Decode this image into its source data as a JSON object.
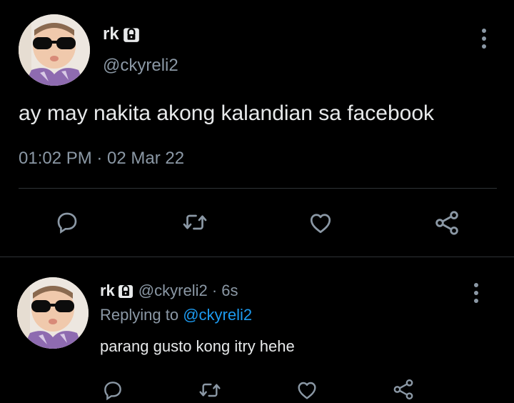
{
  "main_tweet": {
    "display_name": "rk",
    "handle": "@ckyreli2",
    "text": "ay may nakita akong kalandian sa facebook",
    "timestamp": "01:02 PM · 02 Mar 22",
    "icons": {
      "lock": "lock-icon",
      "more": "more-vertical-icon",
      "reply": "reply-icon",
      "retweet": "retweet-icon",
      "like": "heart-icon",
      "share": "share-icon"
    }
  },
  "reply_tweet": {
    "display_name": "rk",
    "handle_time": "@ckyreli2 · 6s",
    "replying_prefix": "Replying to",
    "replying_mention": "@ckyreli2",
    "text": "parang gusto kong itry hehe"
  },
  "colors": {
    "background": "#000000",
    "primary_text": "#e7e9ea",
    "secondary_text": "#8b98a5",
    "link": "#1d9bf0",
    "divider": "#2f3336"
  }
}
